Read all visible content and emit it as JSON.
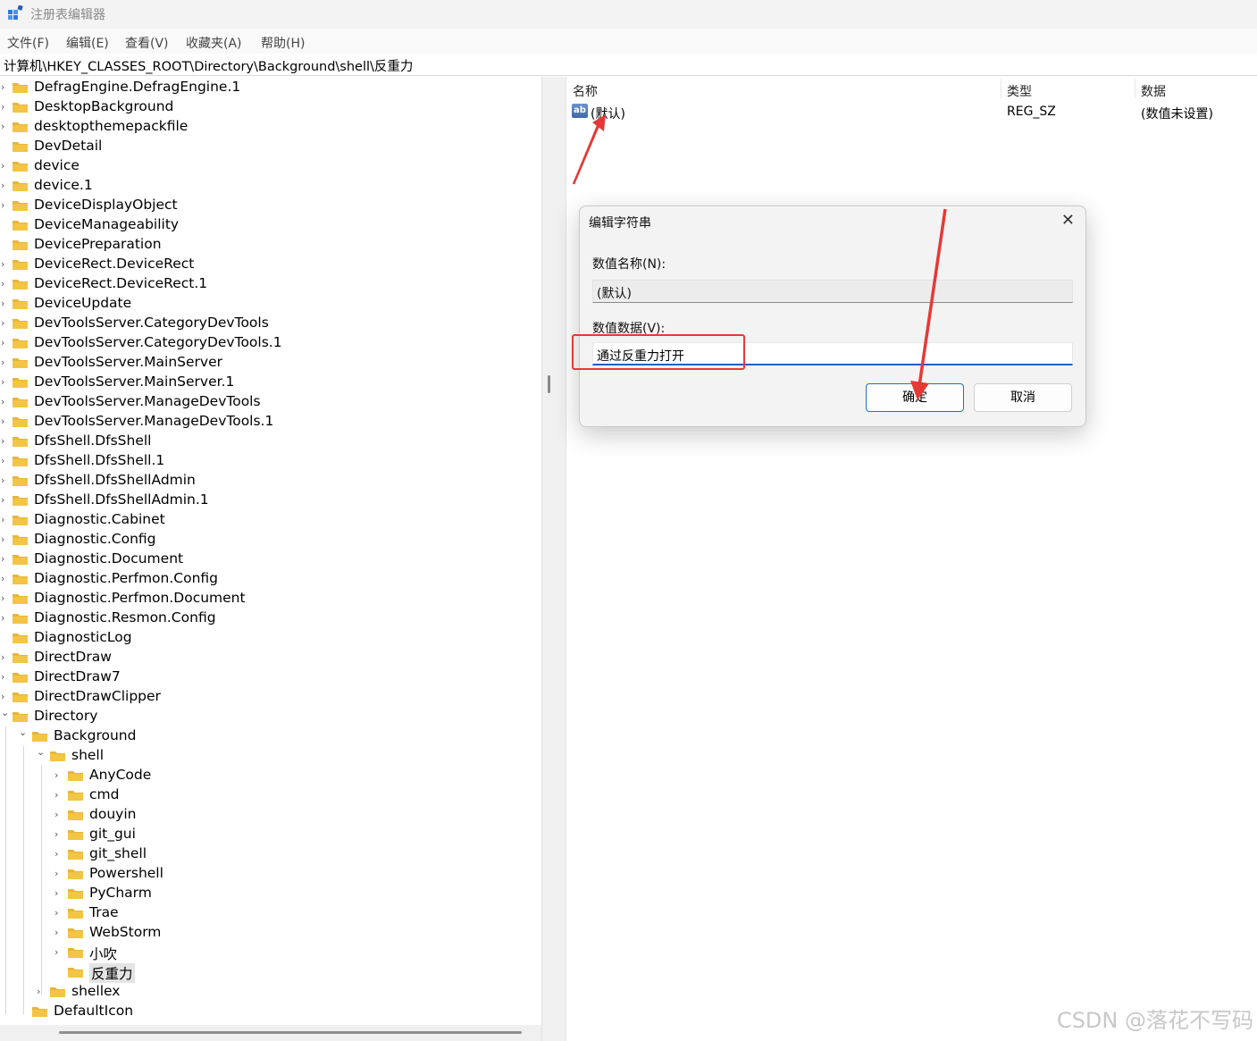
{
  "window": {
    "title": "注册表编辑器",
    "icon": "regedit-icon"
  },
  "menu": [
    "文件(F)",
    "编辑(E)",
    "查看(V)",
    "收藏夹(A)",
    "帮助(H)"
  ],
  "address": "计算机\\HKEY_CLASSES_ROOT\\Directory\\Background\\shell\\反重力",
  "tree": [
    {
      "label": "DefragEngine.DefragEngine.1",
      "level": 0,
      "expand": "collapsed"
    },
    {
      "label": "DesktopBackground",
      "level": 0,
      "expand": "collapsed"
    },
    {
      "label": "desktopthemepackfile",
      "level": 0,
      "expand": "collapsed"
    },
    {
      "label": "DevDetail",
      "level": 0,
      "expand": "none"
    },
    {
      "label": "device",
      "level": 0,
      "expand": "collapsed"
    },
    {
      "label": "device.1",
      "level": 0,
      "expand": "collapsed"
    },
    {
      "label": "DeviceDisplayObject",
      "level": 0,
      "expand": "collapsed"
    },
    {
      "label": "DeviceManageability",
      "level": 0,
      "expand": "none"
    },
    {
      "label": "DevicePreparation",
      "level": 0,
      "expand": "none"
    },
    {
      "label": "DeviceRect.DeviceRect",
      "level": 0,
      "expand": "collapsed"
    },
    {
      "label": "DeviceRect.DeviceRect.1",
      "level": 0,
      "expand": "collapsed"
    },
    {
      "label": "DeviceUpdate",
      "level": 0,
      "expand": "collapsed"
    },
    {
      "label": "DevToolsServer.CategoryDevTools",
      "level": 0,
      "expand": "collapsed"
    },
    {
      "label": "DevToolsServer.CategoryDevTools.1",
      "level": 0,
      "expand": "collapsed"
    },
    {
      "label": "DevToolsServer.MainServer",
      "level": 0,
      "expand": "collapsed"
    },
    {
      "label": "DevToolsServer.MainServer.1",
      "level": 0,
      "expand": "collapsed"
    },
    {
      "label": "DevToolsServer.ManageDevTools",
      "level": 0,
      "expand": "collapsed"
    },
    {
      "label": "DevToolsServer.ManageDevTools.1",
      "level": 0,
      "expand": "collapsed"
    },
    {
      "label": "DfsShell.DfsShell",
      "level": 0,
      "expand": "collapsed"
    },
    {
      "label": "DfsShell.DfsShell.1",
      "level": 0,
      "expand": "collapsed"
    },
    {
      "label": "DfsShell.DfsShellAdmin",
      "level": 0,
      "expand": "collapsed"
    },
    {
      "label": "DfsShell.DfsShellAdmin.1",
      "level": 0,
      "expand": "collapsed"
    },
    {
      "label": "Diagnostic.Cabinet",
      "level": 0,
      "expand": "collapsed"
    },
    {
      "label": "Diagnostic.Config",
      "level": 0,
      "expand": "collapsed"
    },
    {
      "label": "Diagnostic.Document",
      "level": 0,
      "expand": "collapsed"
    },
    {
      "label": "Diagnostic.Perfmon.Config",
      "level": 0,
      "expand": "collapsed"
    },
    {
      "label": "Diagnostic.Perfmon.Document",
      "level": 0,
      "expand": "collapsed"
    },
    {
      "label": "Diagnostic.Resmon.Config",
      "level": 0,
      "expand": "collapsed"
    },
    {
      "label": "DiagnosticLog",
      "level": 0,
      "expand": "none"
    },
    {
      "label": "DirectDraw",
      "level": 0,
      "expand": "collapsed"
    },
    {
      "label": "DirectDraw7",
      "level": 0,
      "expand": "collapsed"
    },
    {
      "label": "DirectDrawClipper",
      "level": 0,
      "expand": "collapsed"
    },
    {
      "label": "Directory",
      "level": 0,
      "expand": "expanded"
    },
    {
      "label": "Background",
      "level": 1,
      "expand": "expanded"
    },
    {
      "label": "shell",
      "level": 2,
      "expand": "expanded"
    },
    {
      "label": "AnyCode",
      "level": 3,
      "expand": "collapsed"
    },
    {
      "label": "cmd",
      "level": 3,
      "expand": "collapsed"
    },
    {
      "label": "douyin",
      "level": 3,
      "expand": "collapsed"
    },
    {
      "label": "git_gui",
      "level": 3,
      "expand": "collapsed"
    },
    {
      "label": "git_shell",
      "level": 3,
      "expand": "collapsed"
    },
    {
      "label": "Powershell",
      "level": 3,
      "expand": "collapsed"
    },
    {
      "label": "PyCharm",
      "level": 3,
      "expand": "collapsed"
    },
    {
      "label": "Trae",
      "level": 3,
      "expand": "collapsed"
    },
    {
      "label": "WebStorm",
      "level": 3,
      "expand": "collapsed"
    },
    {
      "label": "小吹",
      "level": 3,
      "expand": "collapsed"
    },
    {
      "label": "反重力",
      "level": 3,
      "expand": "none",
      "selected": true
    },
    {
      "label": "shellex",
      "level": 2,
      "expand": "collapsed"
    },
    {
      "label": "DefaultIcon",
      "level": 1,
      "expand": "none"
    }
  ],
  "list": {
    "columns": [
      "名称",
      "类型",
      "数据"
    ],
    "rows": [
      {
        "name": "(默认)",
        "type": "REG_SZ",
        "data": "(数值未设置)",
        "icon": "string-value-icon",
        "icon_text": "ab"
      }
    ]
  },
  "dialog": {
    "title": "编辑字符串",
    "name_label": "数值名称(N):",
    "name_value": "(默认)",
    "data_label": "数值数据(V):",
    "data_value": "通过反重力打开",
    "ok": "确定",
    "cancel": "取消"
  },
  "annotations": {
    "highlight_color": "#e53935"
  },
  "watermark": "CSDN @落花不写码",
  "colors": {
    "accent": "#1f5fbf",
    "folder": "#f3c544",
    "selected_bg": "#e4e4e4"
  }
}
